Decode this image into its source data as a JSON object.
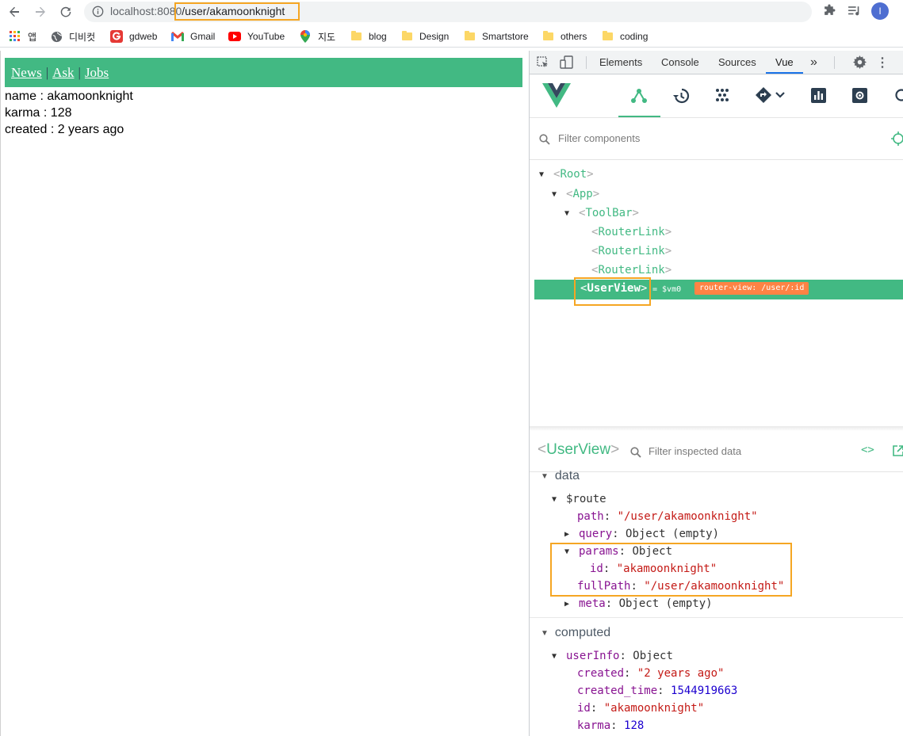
{
  "browser": {
    "url_host": "localhost:8080",
    "url_path": "/user/akamoonknight",
    "profile_initial": "I"
  },
  "bookmarks": [
    {
      "label": "앱",
      "icon": "apps-grid-icon"
    },
    {
      "label": "디비컷",
      "icon": "globe-icon"
    },
    {
      "label": "gdweb",
      "icon": "gdweb-logo-icon"
    },
    {
      "label": "Gmail",
      "icon": "gmail-icon"
    },
    {
      "label": "YouTube",
      "icon": "youtube-icon"
    },
    {
      "label": "지도",
      "icon": "maps-pin-icon"
    },
    {
      "label": "blog",
      "icon": "folder-icon"
    },
    {
      "label": "Design",
      "icon": "folder-icon"
    },
    {
      "label": "Smartstore",
      "icon": "folder-icon"
    },
    {
      "label": "others",
      "icon": "folder-icon"
    },
    {
      "label": "coding",
      "icon": "folder-icon"
    }
  ],
  "page": {
    "nav": [
      "News",
      "Ask",
      "Jobs"
    ],
    "separator": "|",
    "user_lines": [
      "name : akamoonknight",
      "karma : 128",
      "created : 2 years ago"
    ],
    "toolbar_color": "#42b983"
  },
  "devtools": {
    "tabs": [
      "Elements",
      "Console",
      "Sources",
      "Vue"
    ],
    "active_tab": "Vue",
    "filter_components_placeholder": "Filter components",
    "tree": [
      {
        "name": "Root",
        "open": true
      },
      {
        "name": "App",
        "open": true
      },
      {
        "name": "ToolBar",
        "open": true
      },
      {
        "name": "RouterLink"
      },
      {
        "name": "RouterLink"
      },
      {
        "name": "RouterLink"
      }
    ],
    "selected": {
      "name": "UserView",
      "vm": "= $vm0",
      "badge": "router-view: /user/:id"
    },
    "inspector": {
      "title": "UserView",
      "filter_placeholder": "Filter inspected data",
      "data_label": "data",
      "computed_label": "computed",
      "route": {
        "key": "$route",
        "path_key": "path",
        "path_val": "\"/user/akamoonknight\"",
        "query_key": "query",
        "query_val": "Object (empty)",
        "params_key": "params",
        "params_val": "Object",
        "id_key": "id",
        "id_val": "\"akamoonknight\"",
        "fullpath_key": "fullPath",
        "fullpath_val": "\"/user/akamoonknight\"",
        "meta_key": "meta",
        "meta_val": "Object (empty)"
      },
      "userinfo": {
        "key": "userInfo",
        "val": "Object",
        "created_key": "created",
        "created_val": "\"2 years ago\"",
        "created_time_key": "created_time",
        "created_time_val": "1544919663",
        "id_key": "id",
        "id_val": "\"akamoonknight\"",
        "karma_key": "karma",
        "karma_val": "128"
      }
    },
    "accent_color": "#42b983",
    "badge_color": "#ff8344",
    "highlight_color": "#f5a623"
  }
}
